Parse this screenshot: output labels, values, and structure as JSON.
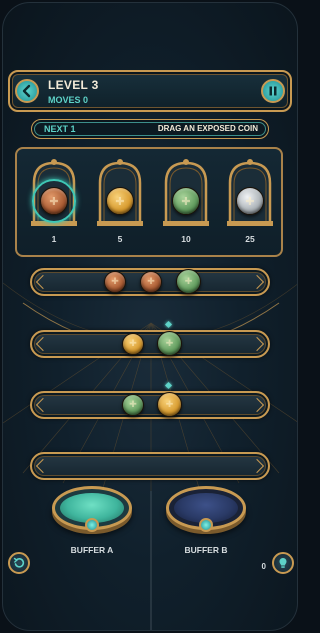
{
  "header": {
    "level_title": "LEVEL 3",
    "moves_label": "MOVES 0",
    "back_icon": "arrow-left-icon",
    "pause_icon": "pause-icon"
  },
  "next_bar": {
    "next_label": "NEXT 1",
    "instruction": "DRAG AN EXPOSED COIN"
  },
  "coin_slots": [
    {
      "value": "1",
      "coin": "copper",
      "selected": true
    },
    {
      "value": "5",
      "coin": "gold",
      "selected": false
    },
    {
      "value": "10",
      "coin": "jade",
      "selected": false
    },
    {
      "value": "25",
      "coin": "silver",
      "selected": false
    }
  ],
  "rails": [
    {
      "coins": [
        "copper",
        "copper",
        "jade"
      ]
    },
    {
      "coins": [
        "gold",
        "jade"
      ]
    },
    {
      "coins": [
        "jade",
        "gold"
      ]
    },
    {
      "coins": []
    }
  ],
  "buffers": [
    {
      "label": "BUFFER A",
      "fill_color": "#3fb59d"
    },
    {
      "label": "BUFFER B",
      "fill_color": "#2a3a66"
    }
  ],
  "footer": {
    "undo_icon": "undo-icon",
    "hint_icon": "hint-icon",
    "hint_count": "0"
  },
  "colors": {
    "accent_teal": "#5ed3c8",
    "gold_trim": "#c89a52",
    "background": "#10202c"
  }
}
